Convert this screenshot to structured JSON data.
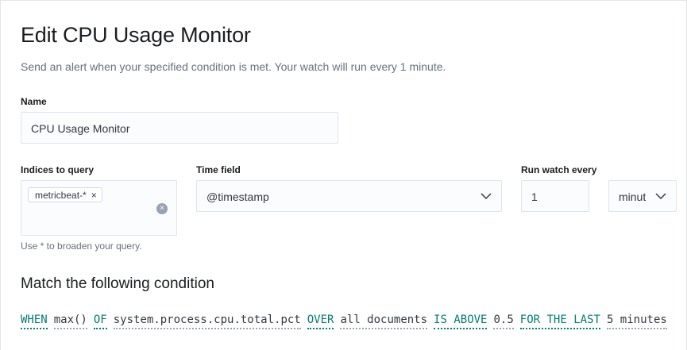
{
  "page": {
    "title": "Edit CPU Usage Monitor",
    "subtitle": "Send an alert when your specified condition is met. Your watch will run every 1 minute."
  },
  "name_field": {
    "label": "Name",
    "value": "CPU Usage Monitor"
  },
  "indices": {
    "label": "Indices to query",
    "pill": "metricbeat-*",
    "help": "Use * to broaden your query.",
    "icons": {
      "pill_close": "×",
      "clear": "×"
    }
  },
  "time_field": {
    "label": "Time field",
    "value": "@timestamp"
  },
  "run_watch": {
    "label": "Run watch every",
    "value": "1",
    "unit": "minut"
  },
  "condition": {
    "heading": "Match the following condition",
    "when_kw": "WHEN",
    "agg": "max()",
    "of_kw": "OF",
    "field": "system.process.cpu.total.pct",
    "over_kw": "OVER",
    "over_val": "all documents",
    "threshold_kw": "IS ABOVE",
    "threshold_val": "0.5",
    "time_kw": "FOR THE LAST",
    "time_val": "5 minutes"
  },
  "colors": {
    "keyword": "#017d73",
    "text": "#343741",
    "muted": "#69707d"
  }
}
